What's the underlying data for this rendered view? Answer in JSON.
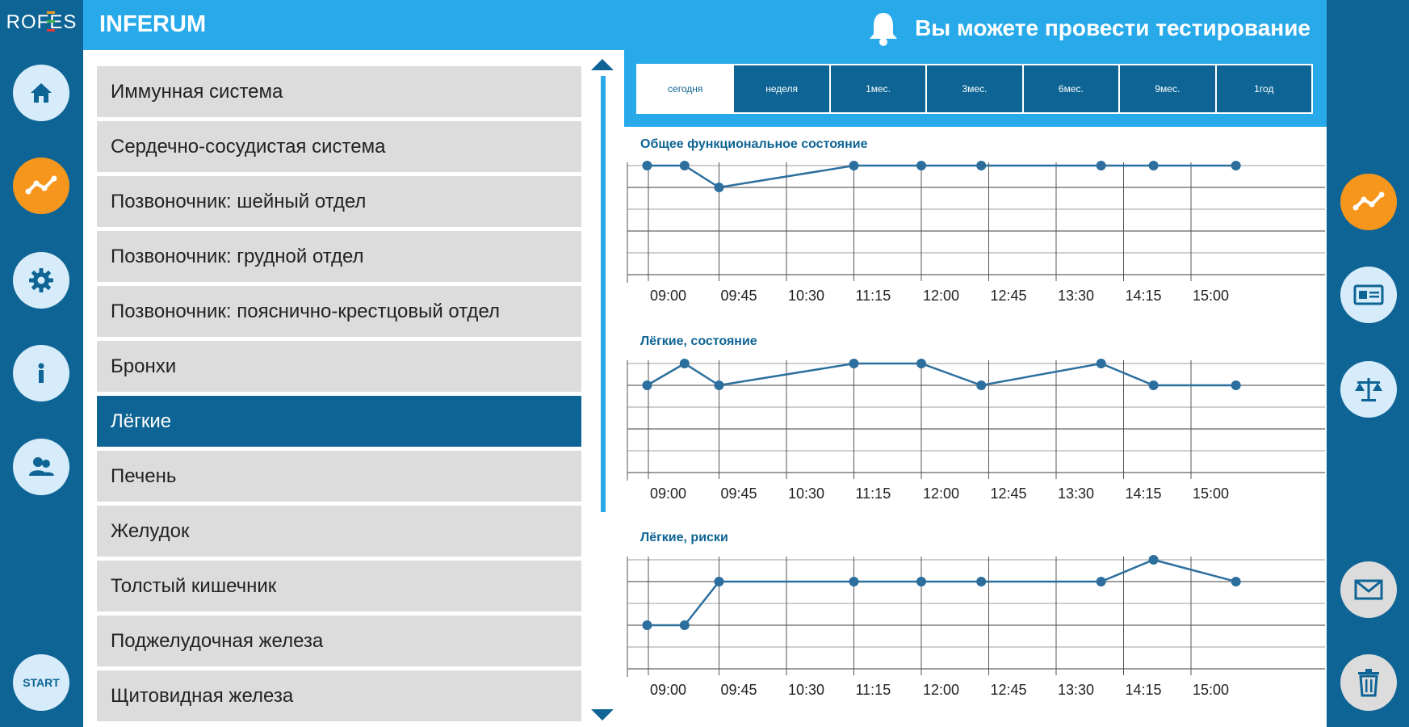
{
  "brand": {
    "logo": "ROFES",
    "app_title": "INFERUM",
    "logo_colors": [
      "#f7961d",
      "#3db24b",
      "#e53935"
    ]
  },
  "notification": {
    "text": "Вы можете провести тестирование",
    "icon": "bell-icon"
  },
  "left_rail": [
    {
      "icon": "home-icon",
      "active": false
    },
    {
      "icon": "chart-icon",
      "active": true
    },
    {
      "icon": "gear-icon",
      "active": false
    },
    {
      "icon": "info-icon",
      "active": false
    },
    {
      "icon": "users-icon",
      "active": false
    }
  ],
  "start_label": "START",
  "right_rail": [
    {
      "icon": "chart-icon",
      "active": true
    },
    {
      "icon": "card-icon",
      "active": false
    },
    {
      "icon": "scales-icon",
      "active": false
    },
    {
      "icon": "mail-icon",
      "active": false
    },
    {
      "icon": "trash-icon",
      "active": false
    }
  ],
  "list": [
    {
      "label": "Иммунная система"
    },
    {
      "label": "Сердечно-сосудистая система"
    },
    {
      "label": "Позвоночник: шейный отдел"
    },
    {
      "label": "Позвоночник: грудной отдел"
    },
    {
      "label": "Позвоночник: пояснично-крестцовый отдел"
    },
    {
      "label": "Бронхи"
    },
    {
      "label": "Лёгкие",
      "selected": true
    },
    {
      "label": "Печень"
    },
    {
      "label": "Желудок"
    },
    {
      "label": "Толстый кишечник"
    },
    {
      "label": "Поджелудочная железа"
    },
    {
      "label": "Щитовидная железа"
    }
  ],
  "tabs": [
    {
      "label": "сегодня",
      "active": true
    },
    {
      "label": "неделя"
    },
    {
      "label": "1мес."
    },
    {
      "label": "3мес."
    },
    {
      "label": "6мес."
    },
    {
      "label": "9мес."
    },
    {
      "label": "1год"
    }
  ],
  "colors": {
    "accent": "#28aaea",
    "dark": "#0e6494",
    "orange": "#f7961d",
    "list_bg": "#dcdcdc"
  },
  "chart_data": [
    {
      "type": "line",
      "title": "Общее функциональное состояние",
      "x_ticks": [
        "09:00",
        "09:45",
        "10:30",
        "11:15",
        "12:00",
        "12:45",
        "13:30",
        "14:15",
        "15:00"
      ],
      "x_range_minutes_from_0900": [
        -5,
        135
      ],
      "y_levels": 5,
      "points": [
        {
          "x": "08:57",
          "level": 5
        },
        {
          "x": "09:22",
          "level": 5
        },
        {
          "x": "09:45",
          "level": 4
        },
        {
          "x": "11:15",
          "level": 5
        },
        {
          "x": "12:00",
          "level": 5
        },
        {
          "x": "12:40",
          "level": 5
        },
        {
          "x": "14:00",
          "level": 5
        },
        {
          "x": "14:35",
          "level": 5
        },
        {
          "x": "15:30",
          "level": 5
        }
      ]
    },
    {
      "type": "line",
      "title": "Лёгкие, состояние",
      "x_ticks": [
        "09:00",
        "09:45",
        "10:30",
        "11:15",
        "12:00",
        "12:45",
        "13:30",
        "14:15",
        "15:00"
      ],
      "y_levels": 5,
      "points": [
        {
          "x": "08:57",
          "level": 4
        },
        {
          "x": "09:22",
          "level": 5
        },
        {
          "x": "09:45",
          "level": 4
        },
        {
          "x": "11:15",
          "level": 5
        },
        {
          "x": "12:00",
          "level": 5
        },
        {
          "x": "12:40",
          "level": 4
        },
        {
          "x": "14:00",
          "level": 5
        },
        {
          "x": "14:35",
          "level": 4
        },
        {
          "x": "15:30",
          "level": 4
        }
      ]
    },
    {
      "type": "line",
      "title": "Лёгкие, риски",
      "x_ticks": [
        "09:00",
        "09:45",
        "10:30",
        "11:15",
        "12:00",
        "12:45",
        "13:30",
        "14:15",
        "15:00"
      ],
      "y_levels": 5,
      "points": [
        {
          "x": "08:57",
          "level": 2
        },
        {
          "x": "09:22",
          "level": 2
        },
        {
          "x": "09:45",
          "level": 4
        },
        {
          "x": "11:15",
          "level": 4
        },
        {
          "x": "12:00",
          "level": 4
        },
        {
          "x": "12:40",
          "level": 4
        },
        {
          "x": "14:00",
          "level": 4
        },
        {
          "x": "14:35",
          "level": 5
        },
        {
          "x": "15:30",
          "level": 4
        }
      ]
    }
  ]
}
